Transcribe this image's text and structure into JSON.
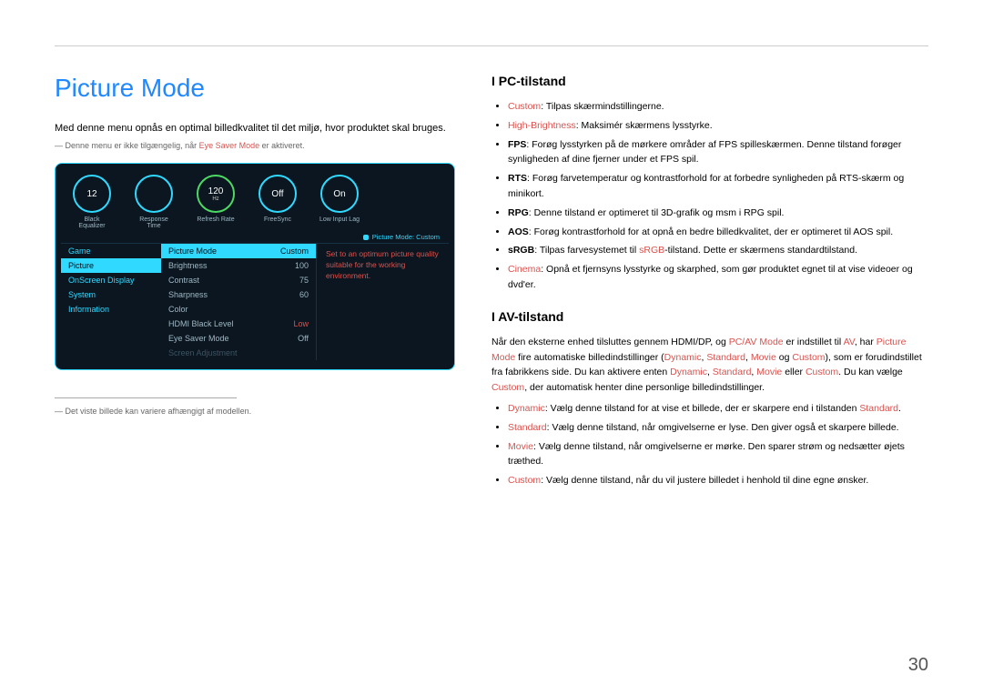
{
  "page_number": "30",
  "title": "Picture Mode",
  "intro": "Med denne menu opnås en optimal billedkvalitet til det miljø, hvor produktet skal bruges.",
  "note_prefix": "― Denne menu er ikke tilgængelig, når ",
  "note_red": "Eye Saver Mode",
  "note_suffix": " er aktiveret.",
  "footnote": "― Det viste billede kan variere afhængigt af modellen.",
  "osd": {
    "gauges": [
      {
        "value": "12",
        "sub": "",
        "label": "Black Equalizer"
      },
      {
        "value": "",
        "sub": "",
        "label": "Response Time"
      },
      {
        "value": "120",
        "sub": "Hz",
        "label": "Refresh Rate"
      },
      {
        "value": "Off",
        "sub": "",
        "label": "FreeSync"
      },
      {
        "value": "On",
        "sub": "",
        "label": "Low Input Lag"
      }
    ],
    "crumb": "Picture Mode: Custom",
    "menu": [
      "Game",
      "Picture",
      "OnScreen Display",
      "System",
      "Information"
    ],
    "menu_selected": 1,
    "sub": [
      {
        "label": "Picture Mode",
        "value": "Custom",
        "sel": true
      },
      {
        "label": "Brightness",
        "value": "100"
      },
      {
        "label": "Contrast",
        "value": "75"
      },
      {
        "label": "Sharpness",
        "value": "60"
      },
      {
        "label": "Color",
        "value": ""
      },
      {
        "label": "HDMI Black Level",
        "value": "Low",
        "lowred": true
      },
      {
        "label": "Eye Saver Mode",
        "value": "Off"
      },
      {
        "label": "Screen Adjustment",
        "value": "",
        "disabled": true
      }
    ],
    "desc": "Set to an optimum picture quality suitable for the working environment."
  },
  "pc": {
    "heading": "I PC-tilstand",
    "items": [
      {
        "term": "Custom",
        "termcolor": "red",
        "text": ": Tilpas skærmindstillingerne."
      },
      {
        "term": "High-Brightness",
        "termcolor": "red",
        "text": ": Maksimér skærmens lysstyrke."
      },
      {
        "term": "FPS",
        "text": ": Forøg lysstyrken på de mørkere områder af FPS spilleskærmen. Denne tilstand forøger synligheden af dine fjerner under et FPS spil."
      },
      {
        "term": "RTS",
        "text": ": Forøg farvetemperatur og kontrastforhold for at forbedre synligheden på RTS-skærm og minikort."
      },
      {
        "term": "RPG",
        "text": ": Denne tilstand er optimeret til 3D-grafik og msm i RPG spil."
      },
      {
        "term": "AOS",
        "text": ": Forøg kontrastforhold for at opnå en bedre billedkvalitet, der er optimeret til AOS spil."
      },
      {
        "term": "sRGB",
        "text_pre": ": Tilpas farvesystemet til ",
        "inner_red": "sRGB",
        "text_post": "-tilstand. Dette er skærmens standardtilstand."
      },
      {
        "term": "Cinema",
        "termcolor": "red",
        "text": ": Opnå et fjernsyns lysstyrke og skarphed, som gør produktet egnet til at vise videoer og dvd'er."
      }
    ]
  },
  "av": {
    "heading": "I AV-tilstand",
    "para_parts": [
      {
        "t": "Når den eksterne enhed tilsluttes gennem HDMI/DP, og "
      },
      {
        "t": "PC/AV Mode",
        "c": "red"
      },
      {
        "t": " er indstillet til "
      },
      {
        "t": "AV",
        "c": "red"
      },
      {
        "t": ", har "
      },
      {
        "t": "Picture Mode",
        "c": "red"
      },
      {
        "t": " fire automatiske billedindstillinger ("
      },
      {
        "t": "Dynamic",
        "c": "red"
      },
      {
        "t": ", "
      },
      {
        "t": "Standard",
        "c": "red"
      },
      {
        "t": ", "
      },
      {
        "t": "Movie",
        "c": "red"
      },
      {
        "t": " og "
      },
      {
        "t": "Custom",
        "c": "red"
      },
      {
        "t": "), som er forudindstillet fra fabrikkens side. Du kan aktivere enten "
      },
      {
        "t": "Dynamic",
        "c": "red"
      },
      {
        "t": ", "
      },
      {
        "t": "Standard",
        "c": "red"
      },
      {
        "t": ", "
      },
      {
        "t": "Movie",
        "c": "red"
      },
      {
        "t": " eller "
      },
      {
        "t": "Custom",
        "c": "red"
      },
      {
        "t": ". Du kan vælge "
      },
      {
        "t": "Custom",
        "c": "red"
      },
      {
        "t": ", der automatisk henter dine personlige billedindstillinger."
      }
    ],
    "items": [
      {
        "term": "Dynamic",
        "termcolor": "red",
        "text_pre": ": Vælg denne tilstand for at vise et billede, der er skarpere end i tilstanden ",
        "inner_red": "Standard",
        "text_post": "."
      },
      {
        "term": "Standard",
        "termcolor": "red",
        "text": ": Vælg denne tilstand, når omgivelserne er lyse. Den giver også et skarpere billede."
      },
      {
        "term": "Movie",
        "termcolor": "red",
        "text": ": Vælg denne tilstand, når omgivelserne er mørke. Den sparer strøm og nedsætter øjets træthed."
      },
      {
        "term": "Custom",
        "termcolor": "red",
        "text": ": Vælg denne tilstand, når du vil justere billedet i henhold til dine egne ønsker."
      }
    ]
  }
}
